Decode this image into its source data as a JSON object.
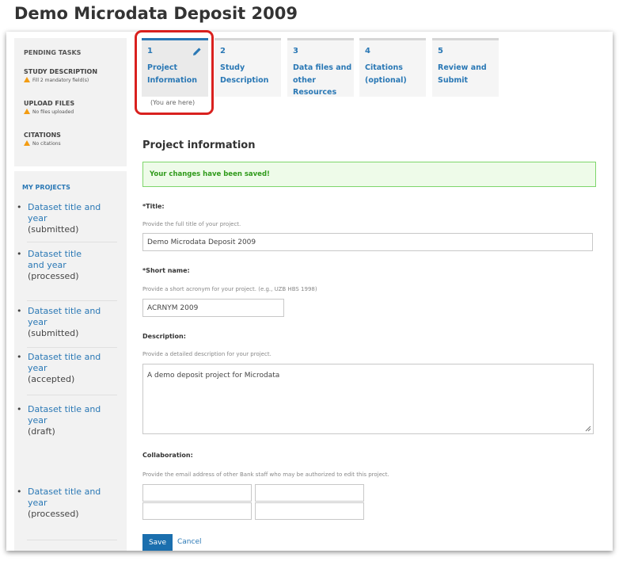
{
  "page_title": "Demo Microdata Deposit 2009",
  "pending": {
    "header": "PENDING TASKS",
    "tasks": [
      {
        "title": "STUDY DESCRIPTION",
        "sub": "Fill 2 mandatory field(s)"
      },
      {
        "title": "UPLOAD FILES",
        "sub": "No files uploaded"
      },
      {
        "title": "CITATIONS",
        "sub": "No citations"
      }
    ]
  },
  "projects": {
    "header": "MY PROJECTS",
    "items": [
      {
        "name": "Dataset title and year",
        "status": "(submitted)"
      },
      {
        "name": "Dataset title and year",
        "status": "(processed)"
      },
      {
        "name": "Dataset title and year",
        "status": "(submitted)"
      },
      {
        "name": "Dataset title and year",
        "status": "(accepted)"
      },
      {
        "name": "Dataset title and year",
        "status": "(draft)"
      },
      {
        "name": "Dataset title and year",
        "status": "(processed)"
      }
    ]
  },
  "steps": [
    {
      "num": "1",
      "label": "Project Information",
      "active": true
    },
    {
      "num": "2",
      "label": "Study Description"
    },
    {
      "num": "3",
      "label": "Data files and other Resources"
    },
    {
      "num": "4",
      "label": "Citations (optional)"
    },
    {
      "num": "5",
      "label": "Review and Submit"
    }
  ],
  "you_are_here": "(You are here)",
  "section_title": "Project information",
  "alert": "Your changes have been saved!",
  "form": {
    "title_label": "*Title:",
    "title_hint": "Provide the full title of your project.",
    "title_value": "Demo Microdata Deposit 2009",
    "short_label": "*Short name:",
    "short_hint": "Provide a short acronym for your project. (e.g., UZB HBS 1998)",
    "short_value": "ACRNYM 2009",
    "desc_label": "Description:",
    "desc_hint": "Provide a detailed description for your project.",
    "desc_value": "A demo deposit project for Microdata",
    "collab_label": "Collaboration:",
    "collab_hint": "Provide the email address of other Bank staff who may be authorized to edit this project."
  },
  "buttons": {
    "save": "Save",
    "cancel": "Cancel"
  },
  "colors": {
    "accent": "#2a78b5",
    "highlight": "#d9211f",
    "success": "#2f9a1a",
    "warning": "#f39c12"
  }
}
